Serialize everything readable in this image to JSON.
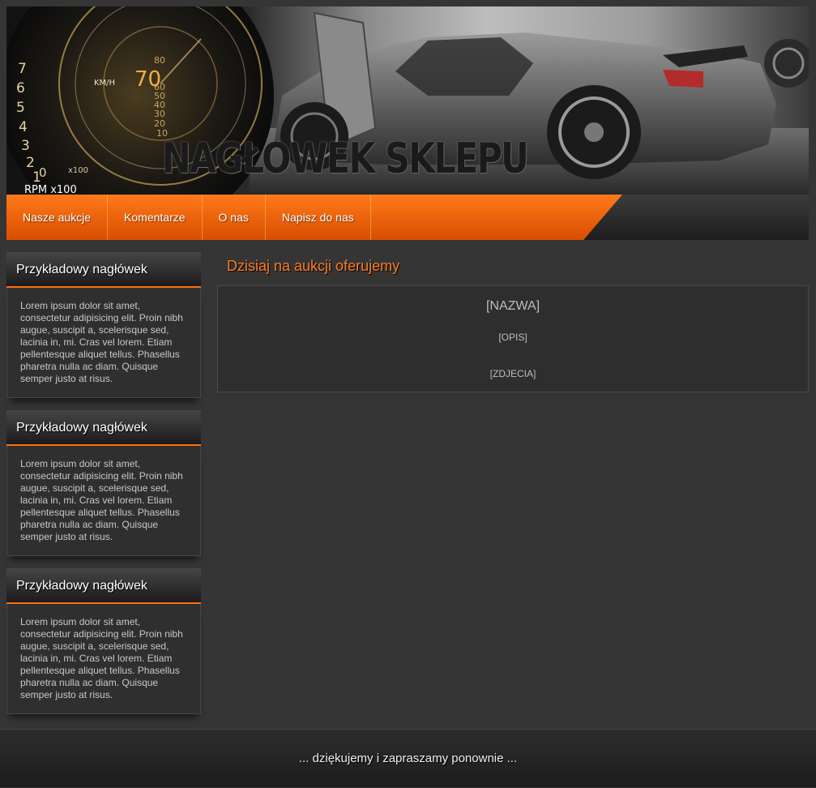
{
  "header": {
    "title": "NAGŁOWEK SKLEPU",
    "gauge": {
      "speed": "70",
      "unit": "KM/H",
      "rpm_label": "RPM x100",
      "scale_label": "x100",
      "numbers": [
        "7",
        "6",
        "5",
        "4",
        "3",
        "2",
        "1",
        "0"
      ],
      "inner_numbers": [
        "80",
        "60",
        "50",
        "40",
        "30",
        "20",
        "10"
      ]
    }
  },
  "nav": {
    "items": [
      {
        "label": "Nasze aukcje"
      },
      {
        "label": "Komentarze"
      },
      {
        "label": "O nas"
      },
      {
        "label": "Napisz do nas"
      }
    ]
  },
  "sidebar": {
    "boxes": [
      {
        "heading": "Przykładowy nagłówek",
        "text": "Lorem ipsum dolor sit amet, consectetur adipisicing elit. Proin nibh augue, suscipit a, scelerisque sed, lacinia in, mi. Cras vel lorem. Etiam pellentesque aliquet tellus. Phasellus pharetra nulla ac diam. Quisque semper justo at risus."
      },
      {
        "heading": "Przykładowy nagłówek",
        "text": "Lorem ipsum dolor sit amet, consectetur adipisicing elit. Proin nibh augue, suscipit a, scelerisque sed, lacinia in, mi. Cras vel lorem. Etiam pellentesque aliquet tellus. Phasellus pharetra nulla ac diam. Quisque semper justo at risus."
      },
      {
        "heading": "Przykładowy nagłówek",
        "text": "Lorem ipsum dolor sit amet, consectetur adipisicing elit. Proin nibh augue, suscipit a, scelerisque sed, lacinia in, mi. Cras vel lorem. Etiam pellentesque aliquet tellus. Phasellus pharetra nulla ac diam. Quisque semper justo at risus."
      }
    ]
  },
  "main": {
    "title": "Dzisiaj na aukcji oferujemy",
    "item": {
      "name": "[NAZWA]",
      "description": "[OPIS]",
      "photos": "[ZDJECIA]"
    }
  },
  "footer": {
    "text": "... dziękujemy i zapraszamy ponownie ..."
  },
  "colors": {
    "accent": "#ff6f0f",
    "background": "#353535",
    "title_accent": "#ff7b25"
  }
}
